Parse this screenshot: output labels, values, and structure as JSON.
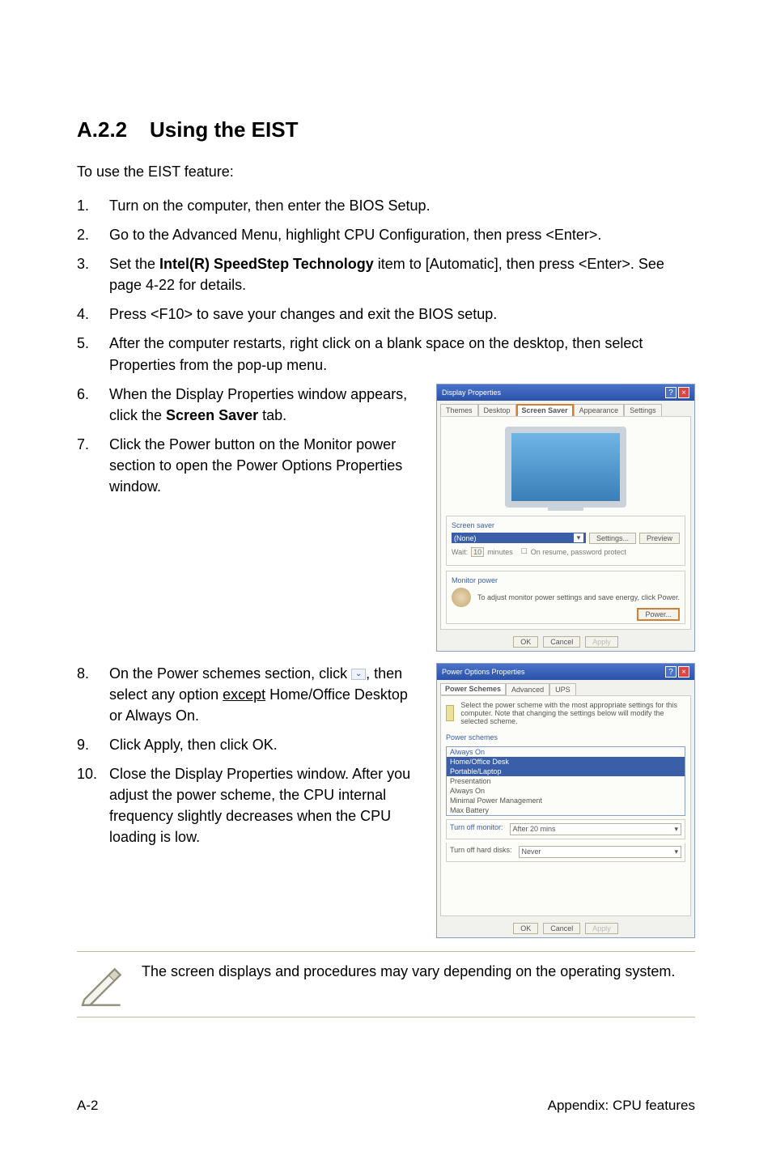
{
  "heading": {
    "number": "A.2.2",
    "title": "Using the EIST"
  },
  "intro": "To use the EIST feature:",
  "steps_a": [
    "Turn on the computer, then enter the BIOS Setup.",
    "Go to the Advanced Menu, highlight CPU Configuration, then press <Enter>.",
    "Set the Intel(R) SpeedStep Technology item to [Automatic], then press <Enter>. See page 4-22 for details.",
    "Press <F10> to save your changes and exit the BIOS setup.",
    "After the computer restarts, right click on a blank space on the desktop, then select Properties from the pop-up menu."
  ],
  "step3_pre": "Set the ",
  "step3_bold": "Intel(R) SpeedStep Technology",
  "step3_post": " item to [Automatic], then press <Enter>. See page 4-22 for details.",
  "step6_pre": "When the Display Properties window appears, click the ",
  "step6_bold": "Screen Saver",
  "step6_post": " tab.",
  "step7": "Click the Power button on the Monitor power section to open the Power Options Properties window.",
  "step8_pre": "On the Power schemes section, click ",
  "step8_post": ", then select any option ",
  "step8_ul": "except",
  "step8_tail": " Home/Office Desktop or Always On.",
  "step9": "Click Apply, then click OK.",
  "step10": "Close the Display Properties window. After you adjust the power scheme, the CPU internal frequency slightly decreases when the CPU loading is low.",
  "dialog1": {
    "title": "Display Properties",
    "tabs": [
      "Themes",
      "Desktop",
      "Screen Saver",
      "Appearance",
      "Settings"
    ],
    "grp1": "Screen saver",
    "sel1": "(None)",
    "btn_settings": "Settings...",
    "btn_preview": "Preview",
    "wait": "Wait:",
    "wait_val": "10",
    "wait_min": "minutes",
    "resume": "On resume, password protect",
    "grp2": "Monitor power",
    "montxt": "To adjust monitor power settings and save energy, click Power.",
    "btn_power": "Power...",
    "ok": "OK",
    "cancel": "Cancel",
    "apply": "Apply"
  },
  "dialog2": {
    "title": "Power Options Properties",
    "tabs": [
      "Power Schemes",
      "Advanced",
      "UPS"
    ],
    "desc": "Select the power scheme with the most appropriate settings for this computer. Note that changing the settings below will modify the selected scheme.",
    "grp": "Power schemes",
    "current": "Always On",
    "options": [
      "Home/Office Desk",
      "Portable/Laptop",
      "Presentation",
      "Always On",
      "Minimal Power Management",
      "Max Battery"
    ],
    "row1_lbl": "Turn off monitor:",
    "row1_val": "After 20 mins",
    "row2_lbl": "Turn off hard disks:",
    "row2_val": "Never",
    "ok": "OK",
    "cancel": "Cancel",
    "apply": "Apply"
  },
  "note": "The screen displays and procedures may vary depending on the operating system.",
  "footer_left": "A-2",
  "footer_right": "Appendix: CPU features"
}
